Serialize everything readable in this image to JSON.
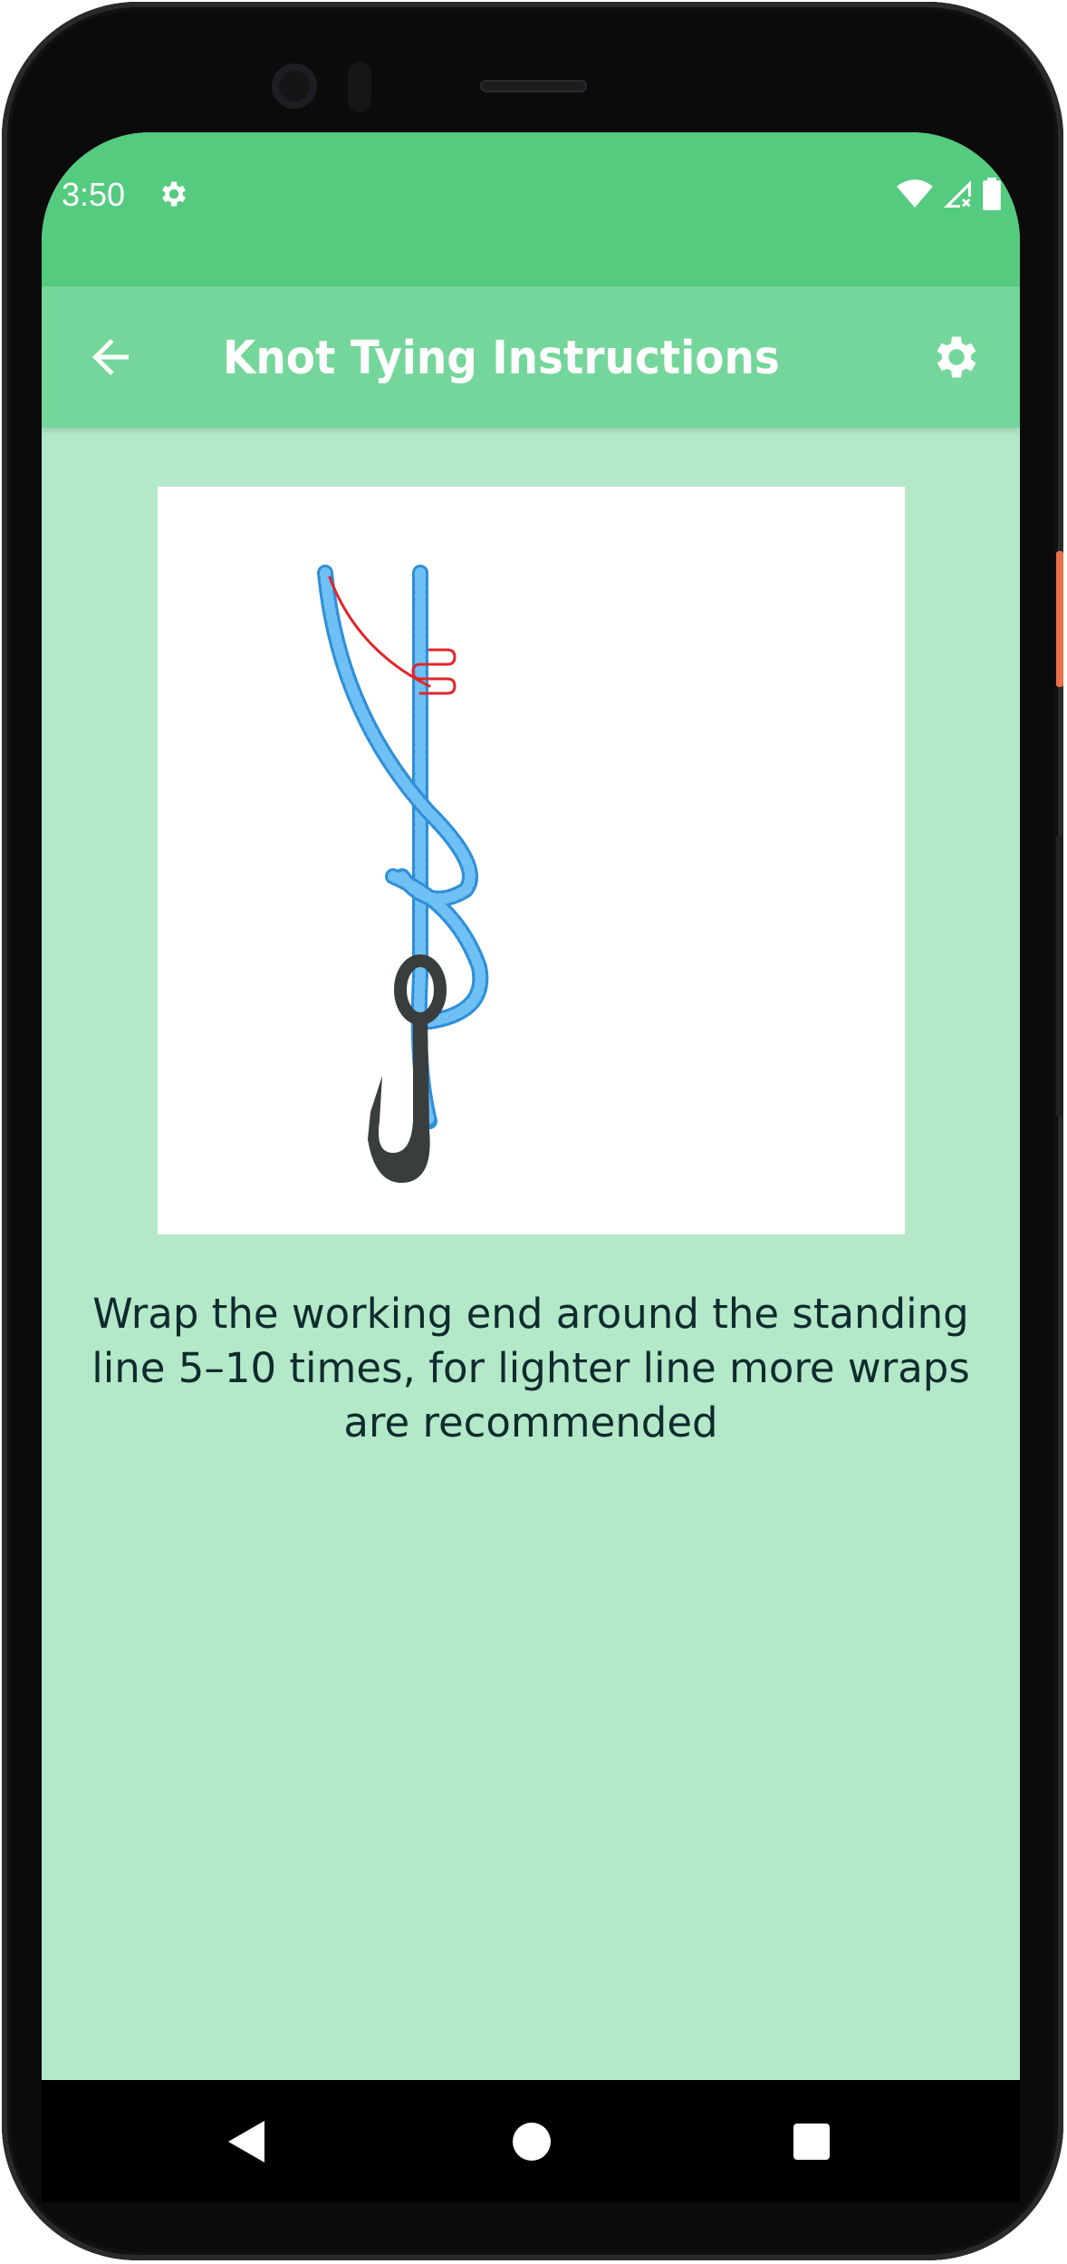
{
  "status_bar": {
    "time": "3:50",
    "icons": [
      "settings-icon",
      "wifi-icon",
      "signal-icon",
      "battery-icon"
    ]
  },
  "app_bar": {
    "title": "Knot Tying Instructions",
    "back_icon": "arrow-back-icon",
    "settings_icon": "gear-icon"
  },
  "step": {
    "description": "Wrap the working end around the standing line 5–10 times, for lighter line more wraps are recommended"
  },
  "nav_bar": {
    "icons": [
      "back-icon",
      "home-icon",
      "recents-icon"
    ]
  },
  "colors": {
    "status_bar": "#55cb80",
    "app_bar": "#74d69a",
    "background": "#b3e9c8",
    "line": "#3aa0e8",
    "arrow": "#e0262b",
    "hook": "#3a3d3d"
  }
}
